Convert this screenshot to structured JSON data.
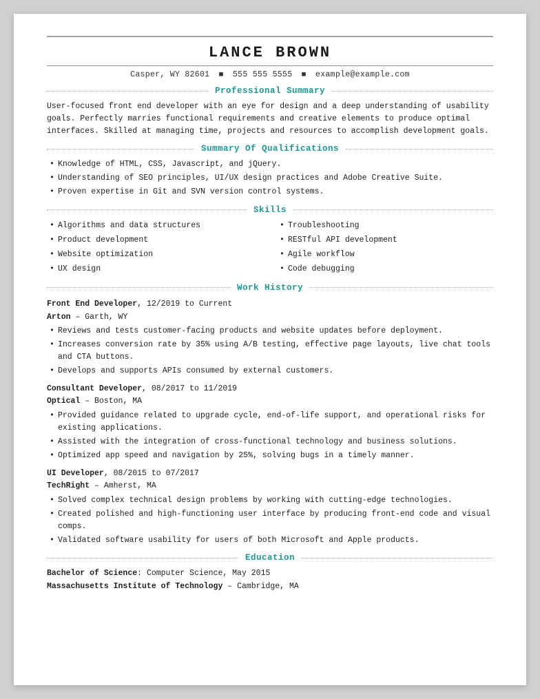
{
  "header": {
    "name": "Lance Brown",
    "contact": {
      "city": "Casper, WY 82601",
      "phone": "555 555 5555",
      "email": "example@example.com"
    }
  },
  "sections": {
    "professional_summary": {
      "title": "Professional Summary",
      "text": "User-focused front end developer with an eye for design and a deep understanding of usability goals. Perfectly marries functional requirements and creative elements to produce optimal interfaces. Skilled at managing time, projects and resources to accomplish development goals."
    },
    "qualifications": {
      "title": "Summary Of Qualifications",
      "items": [
        "Knowledge of HTML, CSS, Javascript, and jQuery.",
        "Understanding of SEO principles, UI/UX design practices and Adobe Creative Suite.",
        "Proven expertise in Git and SVN version control systems."
      ]
    },
    "skills": {
      "title": "Skills",
      "items": [
        "Algorithms and data structures",
        "Troubleshooting",
        "Product development",
        "RESTful API development",
        "Website optimization",
        "Agile workflow",
        "UX design",
        "Code debugging"
      ]
    },
    "work_history": {
      "title": "Work History",
      "jobs": [
        {
          "title": "Front End Developer",
          "dates": "12/2019 to Current",
          "company": "Arton",
          "location": "Garth, WY",
          "bullets": [
            "Reviews and tests customer-facing products and website updates before deployment.",
            "Increases conversion rate by 35% using A/B testing, effective page layouts, live chat tools and CTA buttons.",
            "Develops and supports APIs consumed by external customers."
          ]
        },
        {
          "title": "Consultant Developer",
          "dates": "08/2017 to 11/2019",
          "company": "Optical",
          "location": "Boston, MA",
          "bullets": [
            "Provided guidance related to upgrade cycle, end-of-life support, and operational risks for existing applications.",
            "Assisted with the integration of cross-functional technology and business solutions.",
            "Optimized app speed and navigation by 25%, solving bugs in a timely manner."
          ]
        },
        {
          "title": "UI Developer",
          "dates": "08/2015 to 07/2017",
          "company": "TechRight",
          "location": "Amherst, MA",
          "bullets": [
            "Solved complex technical design problems by working with cutting-edge technologies.",
            "Created polished and high-functioning user interface by producing front-end code and visual comps.",
            "Validated software usability for users of both Microsoft and Apple products."
          ]
        }
      ]
    },
    "education": {
      "title": "Education",
      "items": [
        {
          "degree": "Bachelor of Science",
          "field": "Computer Science, May 2015",
          "institution": "Massachusetts Institute of Technology",
          "location": "Cambridge, MA"
        }
      ]
    }
  }
}
